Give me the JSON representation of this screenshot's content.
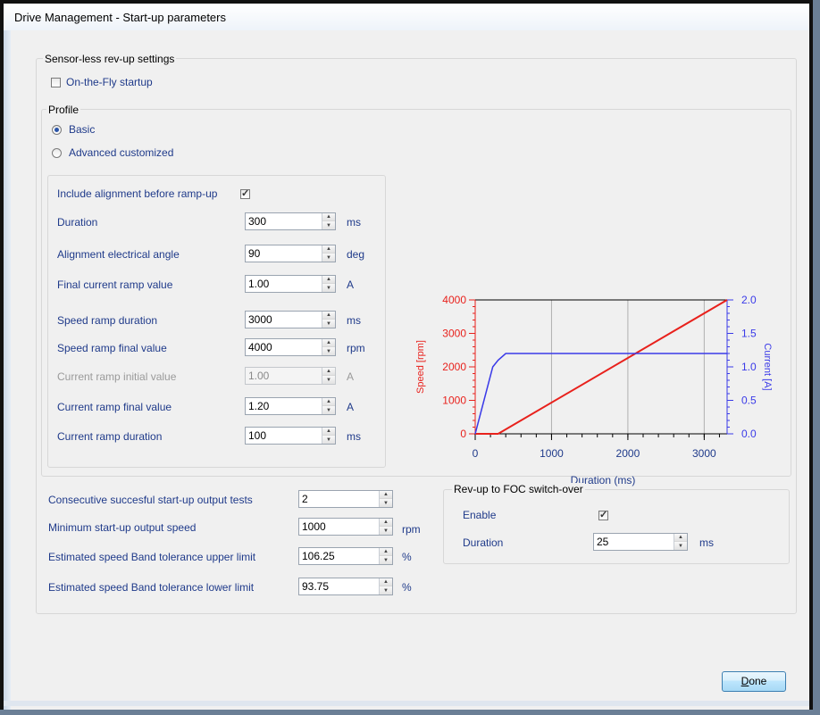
{
  "window": {
    "title": "Drive Management - Start-up parameters"
  },
  "sensorless": {
    "group_label": "Sensor-less rev-up settings",
    "on_the_fly_label": "On-the-Fly startup",
    "profile_label": "Profile",
    "basic_label": "Basic",
    "advanced_label": "Advanced customized",
    "include_alignment_label": "Include alignment before ramp-up",
    "duration_label": "Duration",
    "duration_value": "300",
    "duration_unit": "ms",
    "align_angle_label": "Alignment electrical angle",
    "align_angle_value": "90",
    "align_angle_unit": "deg",
    "final_current_label": "Final current ramp value",
    "final_current_value": "1.00",
    "final_current_unit": "A",
    "speed_ramp_duration_label": "Speed ramp duration",
    "speed_ramp_duration_value": "3000",
    "speed_ramp_duration_unit": "ms",
    "speed_ramp_final_label": "Speed ramp final value",
    "speed_ramp_final_value": "4000",
    "speed_ramp_final_unit": "rpm",
    "current_ramp_initial_label": "Current ramp initial value",
    "current_ramp_initial_value": "1.00",
    "current_ramp_initial_unit": "A",
    "current_ramp_final_label": "Current ramp final value",
    "current_ramp_final_value": "1.20",
    "current_ramp_final_unit": "A",
    "current_ramp_duration_label": "Current ramp duration",
    "current_ramp_duration_value": "100",
    "current_ramp_duration_unit": "ms"
  },
  "chart_data": {
    "type": "line",
    "xlabel": "Duration (ms)",
    "ylabel": "Speed [rpm]",
    "y2label": "Current [A]",
    "xlim": [
      0,
      3300
    ],
    "ylim": [
      0,
      4000
    ],
    "y2lim": [
      0,
      2.0
    ],
    "xticks": [
      "0",
      "1000",
      "2000",
      "3000"
    ],
    "yticks": [
      "0",
      "1000",
      "2000",
      "3000",
      "4000"
    ],
    "y2ticks": [
      "0.0",
      "0.5",
      "1.0",
      "1.5",
      "2.0"
    ],
    "grid": true,
    "colors": {
      "speed": "#e8211c",
      "current": "#3a3ae8"
    },
    "series": [
      {
        "axis": "left",
        "x": [
          0,
          300,
          3300
        ],
        "y": [
          0,
          0,
          4000
        ]
      },
      {
        "axis": "right",
        "x": [
          0,
          230,
          300,
          400,
          3300
        ],
        "y": [
          0,
          1.0,
          1.1,
          1.2,
          1.2
        ]
      }
    ]
  },
  "outputs": {
    "consecutive_label": "Consecutive succesful start-up output tests",
    "consecutive_value": "2",
    "min_speed_label": "Minimum start-up output speed",
    "min_speed_value": "1000",
    "min_speed_unit": "rpm",
    "upper_label": "Estimated speed Band tolerance upper limit",
    "upper_value": "106.25",
    "upper_unit": "%",
    "lower_label": "Estimated speed Band tolerance lower limit",
    "lower_value": "93.75",
    "lower_unit": "%"
  },
  "foc": {
    "group_label": "Rev-up to FOC switch-over",
    "enable_label": "Enable",
    "duration_label": "Duration",
    "duration_value": "25",
    "duration_unit": "ms"
  },
  "done_button": {
    "label_underlined": "D",
    "label_rest": "one"
  }
}
